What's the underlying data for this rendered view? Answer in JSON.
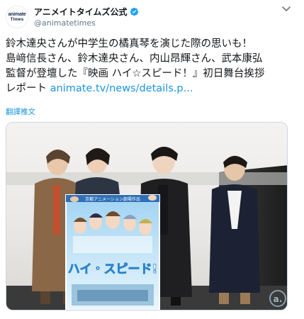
{
  "tweet": {
    "avatar_text_line1": "animate",
    "avatar_text_line2": "Times",
    "display_name": "アニメイトタイムズ公式",
    "handle": "@animatetimes",
    "verified_icon": "verified-badge-icon",
    "body_lines": [
      "鈴木達央さんが中学生の橘真琴を演じた際の思いも！",
      "島﨑信長さん、鈴木達央さん、内山昂輝さん、武本康弘",
      "監督が登壇した『映画 ハイ☆スピード！』初日舞台挨拶"
    ],
    "body_line4_prefix": "レポート ",
    "link_text": "animate.tv/news/details.p...",
    "translate_label": "翻譯推文",
    "photo": {
      "poster_title": "ハイ・スピード!",
      "poster_banner": "京都アニメーション劇場作品",
      "watermark": "a."
    },
    "colors": {
      "link": "#1b95e0",
      "verified": "#1da1f2",
      "secondary_text": "#657786"
    }
  }
}
